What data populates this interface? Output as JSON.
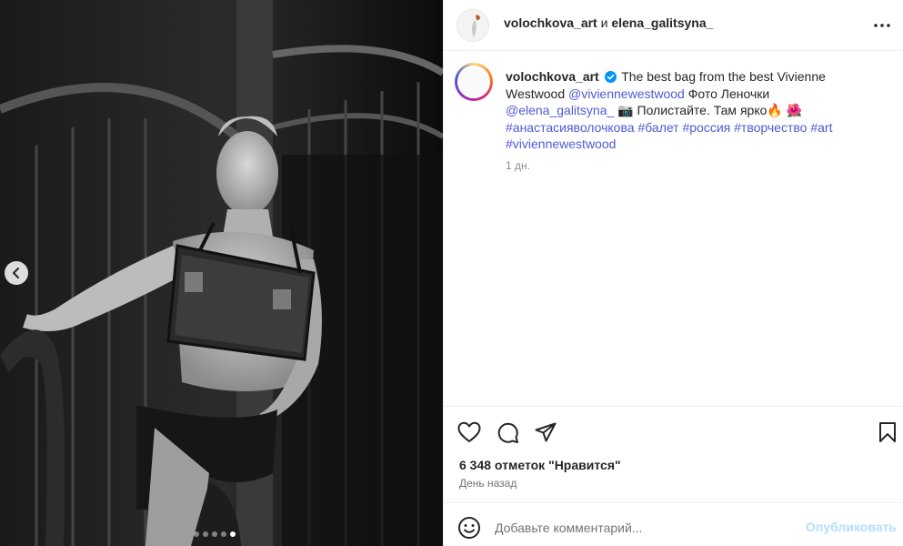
{
  "post": {
    "header": {
      "author": "volochkova_art",
      "conj": "и",
      "coauthor": "elena_galitsyna_"
    },
    "caption": {
      "username": "volochkova_art",
      "text_1": "The best bag from the best Vivienne Westwood",
      "mention_1": "@viviennewestwood",
      "text_2": "Фото Леночки",
      "mention_2": "@elena_galitsyna_",
      "camera_emoji": "📷",
      "text_3": "Полистайте. Там ярко",
      "fire_emoji": "🔥",
      "flower_emoji": "🌺",
      "hashtags": [
        "#анастасияволочкова",
        "#балет",
        "#россия",
        "#творчество",
        "#art",
        "#viviennewestwood"
      ],
      "time": "1 дн."
    },
    "likes": "6 348 отметок \"Нравится\"",
    "date": "День назад",
    "comment": {
      "placeholder": "Добавьте комментарий...",
      "publish": "Опубликовать"
    },
    "carousel": {
      "total": 5,
      "active": 5
    }
  },
  "colors": {
    "link": "#4f5bd5",
    "publish_disabled": "#b2dffc",
    "verified": "#0095f6"
  },
  "icons": [
    "chevron-left-icon",
    "more-horizontal-icon",
    "verified-badge-icon",
    "heart-icon",
    "comment-icon",
    "share-icon",
    "bookmark-icon",
    "emoji-icon"
  ]
}
